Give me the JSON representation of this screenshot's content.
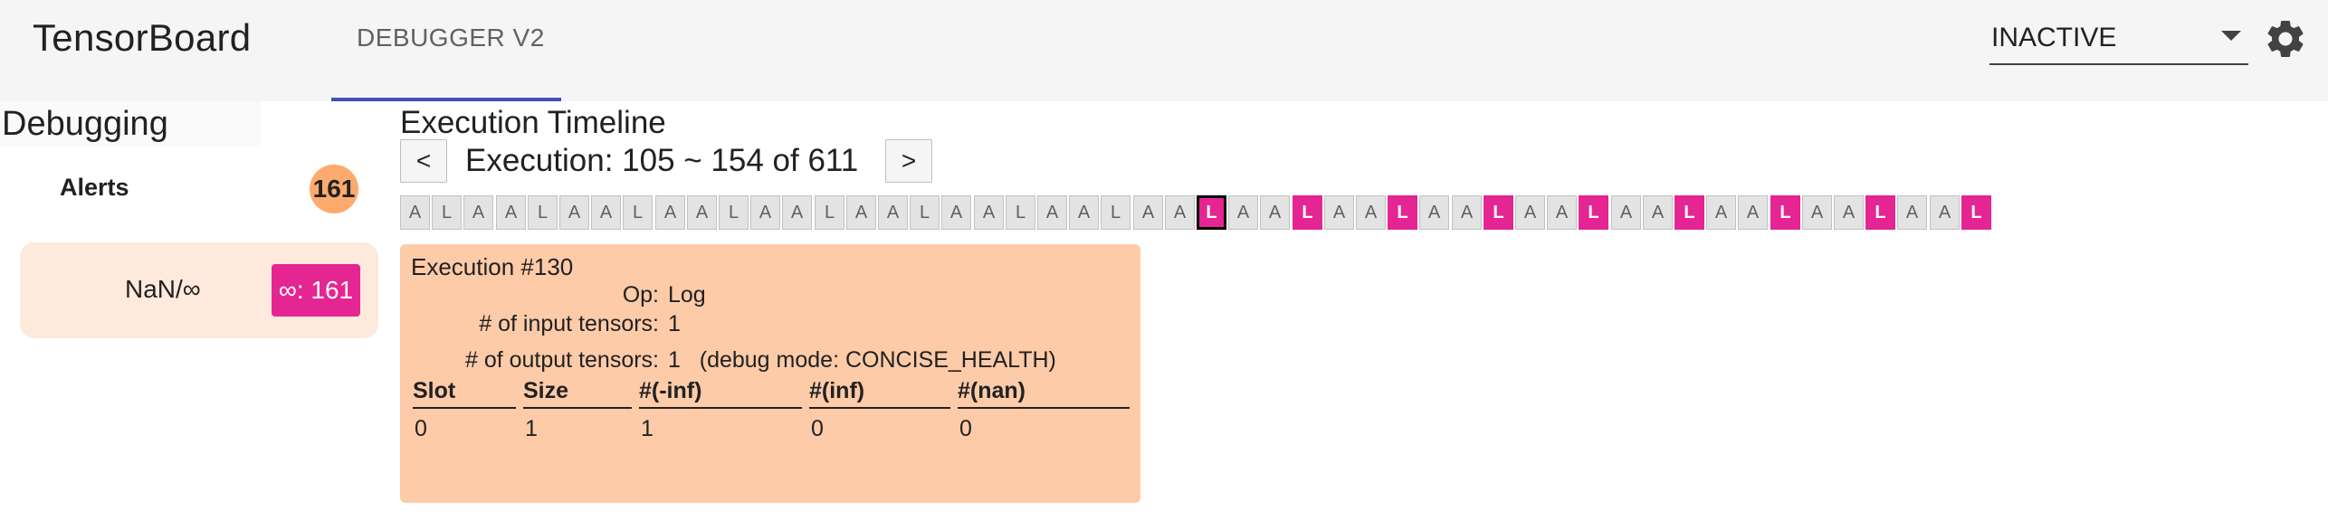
{
  "header": {
    "title": "TensorBoard",
    "tab_label": "DEBUGGER V2",
    "status_value": "INACTIVE",
    "gear_icon": "settings-icon",
    "colors": {
      "tab_underline": "#3f51b5",
      "background": "#f5f5f5"
    }
  },
  "sidebar": {
    "title": "Debugging",
    "alerts_label": "Alerts",
    "alerts_count": "161",
    "nan_label": "NaN/∞",
    "nan_badge": "∞: 161",
    "colors": {
      "alerts_badge": "#fdaa6e",
      "nan_badge": "#e52592",
      "nan_item": "#fdeadc"
    }
  },
  "timeline": {
    "title": "Execution Timeline",
    "prev_label": "<",
    "next_label": ">",
    "range_text": "Execution: 105 ~ 154 of 611",
    "cells": [
      {
        "label": "A",
        "alert": false,
        "selected": false
      },
      {
        "label": "L",
        "alert": false,
        "selected": false
      },
      {
        "label": "A",
        "alert": false,
        "selected": false
      },
      {
        "label": "A",
        "alert": false,
        "selected": false
      },
      {
        "label": "L",
        "alert": false,
        "selected": false
      },
      {
        "label": "A",
        "alert": false,
        "selected": false
      },
      {
        "label": "A",
        "alert": false,
        "selected": false
      },
      {
        "label": "L",
        "alert": false,
        "selected": false
      },
      {
        "label": "A",
        "alert": false,
        "selected": false
      },
      {
        "label": "A",
        "alert": false,
        "selected": false
      },
      {
        "label": "L",
        "alert": false,
        "selected": false
      },
      {
        "label": "A",
        "alert": false,
        "selected": false
      },
      {
        "label": "A",
        "alert": false,
        "selected": false
      },
      {
        "label": "L",
        "alert": false,
        "selected": false
      },
      {
        "label": "A",
        "alert": false,
        "selected": false
      },
      {
        "label": "A",
        "alert": false,
        "selected": false
      },
      {
        "label": "L",
        "alert": false,
        "selected": false
      },
      {
        "label": "A",
        "alert": false,
        "selected": false
      },
      {
        "label": "A",
        "alert": false,
        "selected": false
      },
      {
        "label": "L",
        "alert": false,
        "selected": false
      },
      {
        "label": "A",
        "alert": false,
        "selected": false
      },
      {
        "label": "A",
        "alert": false,
        "selected": false
      },
      {
        "label": "L",
        "alert": false,
        "selected": false
      },
      {
        "label": "A",
        "alert": false,
        "selected": false
      },
      {
        "label": "A",
        "alert": false,
        "selected": false
      },
      {
        "label": "L",
        "alert": true,
        "selected": true
      },
      {
        "label": "A",
        "alert": false,
        "selected": false
      },
      {
        "label": "A",
        "alert": false,
        "selected": false
      },
      {
        "label": "L",
        "alert": true,
        "selected": false
      },
      {
        "label": "A",
        "alert": false,
        "selected": false
      },
      {
        "label": "A",
        "alert": false,
        "selected": false
      },
      {
        "label": "L",
        "alert": true,
        "selected": false
      },
      {
        "label": "A",
        "alert": false,
        "selected": false
      },
      {
        "label": "A",
        "alert": false,
        "selected": false
      },
      {
        "label": "L",
        "alert": true,
        "selected": false
      },
      {
        "label": "A",
        "alert": false,
        "selected": false
      },
      {
        "label": "A",
        "alert": false,
        "selected": false
      },
      {
        "label": "L",
        "alert": true,
        "selected": false
      },
      {
        "label": "A",
        "alert": false,
        "selected": false
      },
      {
        "label": "A",
        "alert": false,
        "selected": false
      },
      {
        "label": "L",
        "alert": true,
        "selected": false
      },
      {
        "label": "A",
        "alert": false,
        "selected": false
      },
      {
        "label": "A",
        "alert": false,
        "selected": false
      },
      {
        "label": "L",
        "alert": true,
        "selected": false
      },
      {
        "label": "A",
        "alert": false,
        "selected": false
      },
      {
        "label": "A",
        "alert": false,
        "selected": false
      },
      {
        "label": "L",
        "alert": true,
        "selected": false
      },
      {
        "label": "A",
        "alert": false,
        "selected": false
      },
      {
        "label": "A",
        "alert": false,
        "selected": false
      },
      {
        "label": "L",
        "alert": true,
        "selected": false
      }
    ],
    "colors": {
      "alert_cell": "#e52592",
      "normal_cell": "#e3e3e3"
    }
  },
  "detail": {
    "heading": "Execution #130",
    "op_key": "Op:",
    "op_value": "Log",
    "inputs_key": "# of input tensors:",
    "inputs_value": "1",
    "outputs_key": "# of output tensors:",
    "outputs_value": "1   (debug mode: CONCISE_HEALTH)",
    "table": {
      "headers": [
        "Slot",
        "Size",
        "#(-inf)",
        "#(inf)",
        "#(nan)"
      ],
      "row": [
        "0",
        "1",
        "1",
        "0",
        "0"
      ]
    },
    "colors": {
      "background": "#fdcba8"
    }
  }
}
